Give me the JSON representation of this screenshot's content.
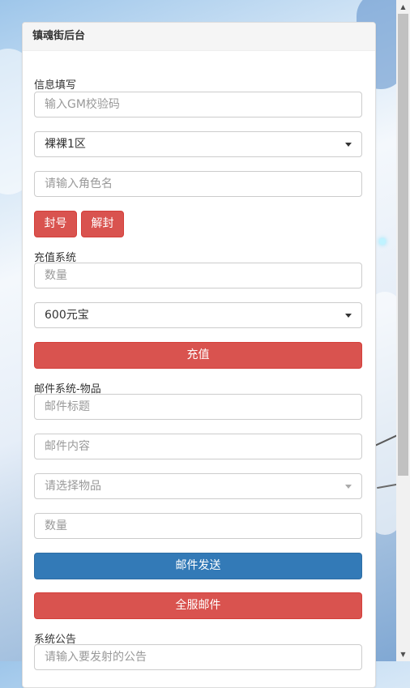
{
  "panel": {
    "title": "镇魂街后台"
  },
  "info_section": {
    "label": "信息填写",
    "gm_code_placeholder": "输入GM校验码",
    "server_selected": "裸裸1区",
    "role_placeholder": "请输入角色名",
    "ban_label": "封号",
    "unban_label": "解封"
  },
  "recharge_section": {
    "label": "充值系统",
    "amount_placeholder": "数量",
    "package_selected": "600元宝",
    "recharge_label": "充值"
  },
  "mail_section": {
    "label": "邮件系统-物品",
    "title_placeholder": "邮件标题",
    "content_placeholder": "邮件内容",
    "item_placeholder": "请选择物品",
    "quantity_placeholder": "数量",
    "send_label": "邮件发送",
    "send_all_label": "全服邮件"
  },
  "notice_section": {
    "label": "系统公告",
    "notice_placeholder": "请输入要发射的公告"
  },
  "colors": {
    "danger": "#d9534f",
    "primary": "#337ab7"
  }
}
